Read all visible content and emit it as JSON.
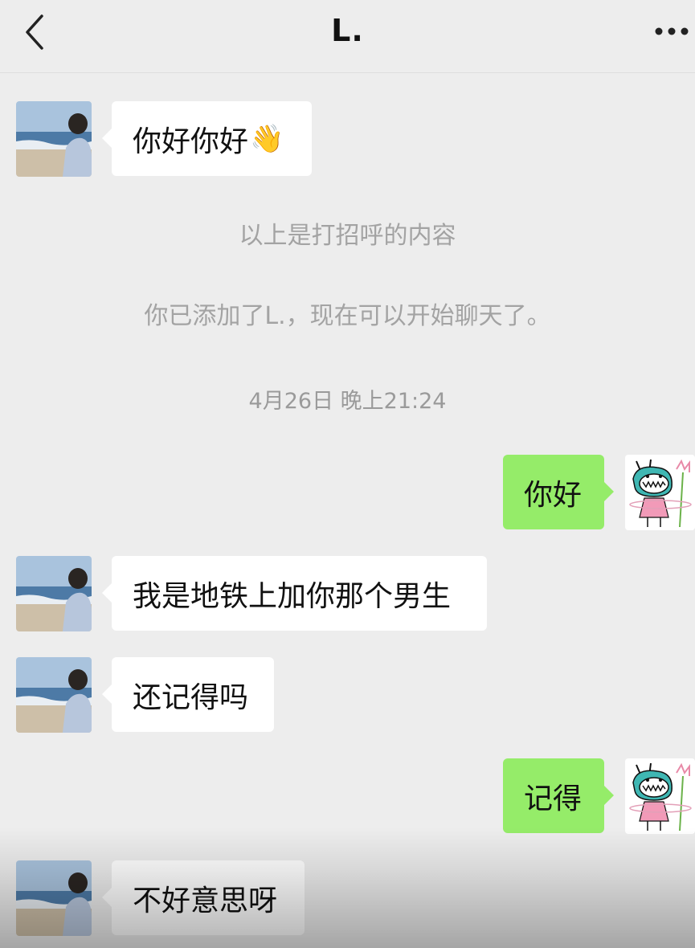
{
  "header": {
    "title": "L.",
    "back_icon": "chevron-left-icon",
    "more_icon": "more-dots-icon"
  },
  "colors": {
    "background": "#ededed",
    "incoming_bubble": "#ffffff",
    "outgoing_bubble": "#95ec69",
    "system_text": "#a3a3a3"
  },
  "messages": [
    {
      "side": "left",
      "text": "你好你好",
      "emoji": "👋"
    },
    {
      "type": "system",
      "text": "以上是打招呼的内容"
    },
    {
      "type": "system",
      "text": "你已添加了L.，现在可以开始聊天了。"
    },
    {
      "type": "time",
      "text": "4月26日 晚上21:24"
    },
    {
      "side": "right",
      "text": "你好"
    },
    {
      "side": "left",
      "text": "我是地铁上加你那个男生"
    },
    {
      "side": "left",
      "text": "还记得吗"
    },
    {
      "side": "right",
      "text": "记得"
    },
    {
      "side": "left",
      "text": "不好意思呀"
    }
  ]
}
